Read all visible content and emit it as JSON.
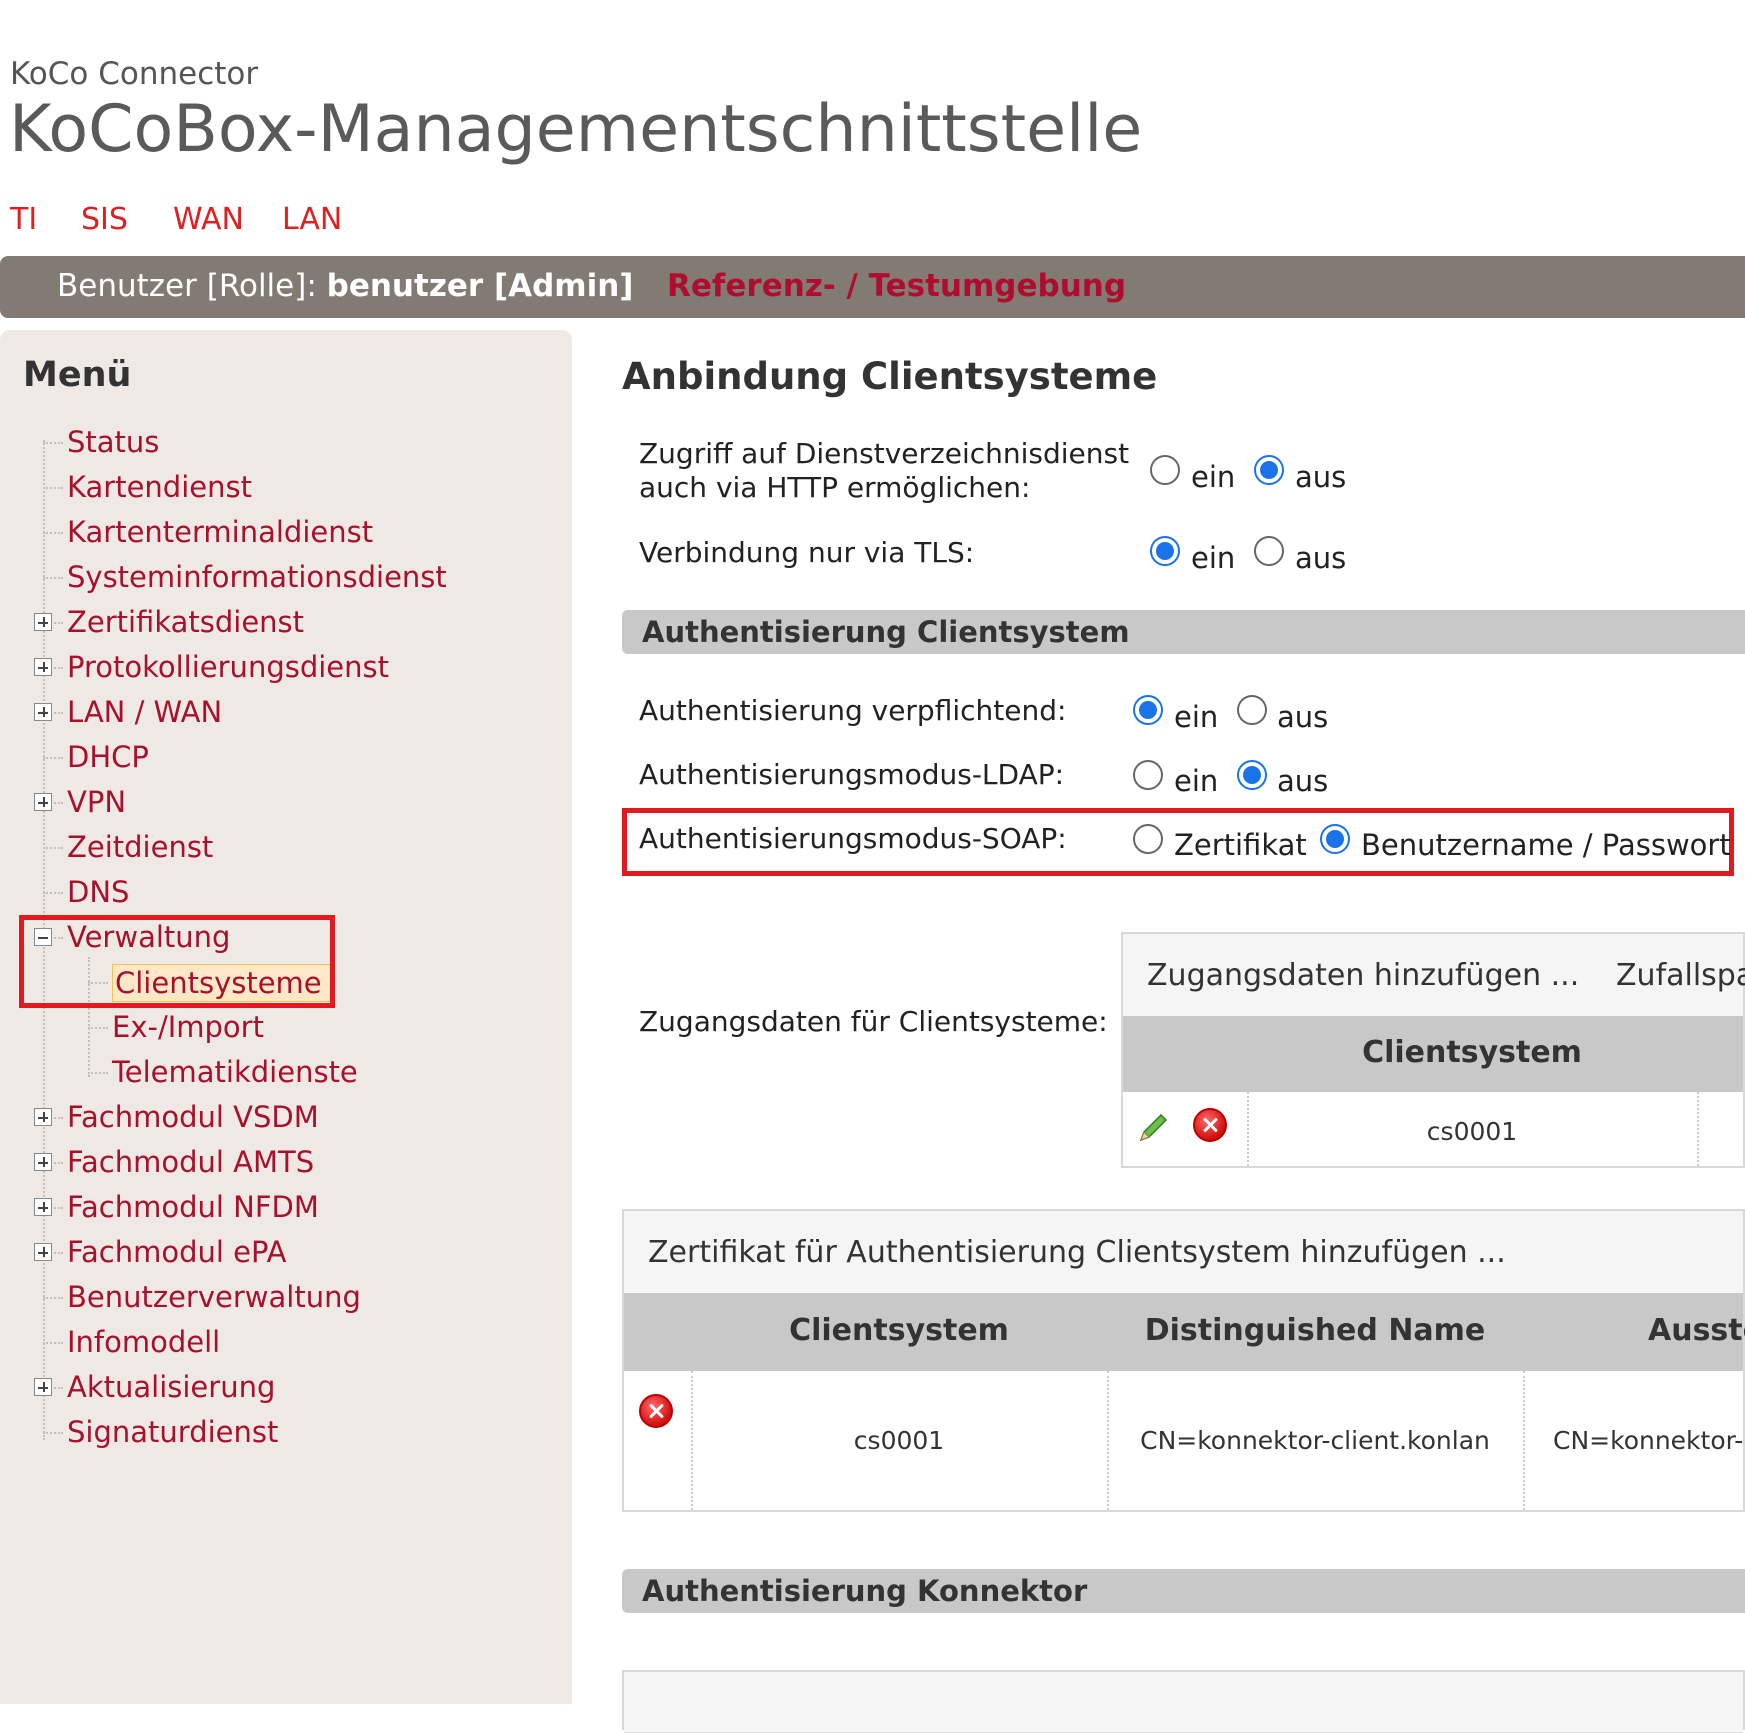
{
  "header": {
    "subtitle": "KoCo Connector",
    "title": "KoCoBox-Managementschnittstelle"
  },
  "top_nav": [
    {
      "label": "TI"
    },
    {
      "label": "SIS"
    },
    {
      "label": "WAN"
    },
    {
      "label": "LAN"
    }
  ],
  "user_bar": {
    "role_label": "Benutzer [Rolle]: ",
    "user": "benutzer [Admin]",
    "environment": "Referenz- / Testumgebung"
  },
  "menu": {
    "title": "Menü",
    "items": [
      {
        "label": "Status",
        "expander": "none"
      },
      {
        "label": "Kartendienst",
        "expander": "none"
      },
      {
        "label": "Kartenterminaldienst",
        "expander": "none"
      },
      {
        "label": "Systeminformationsdienst",
        "expander": "none"
      },
      {
        "label": "Zertifikatsdienst",
        "expander": "plus"
      },
      {
        "label": "Protokollierungsdienst",
        "expander": "plus"
      },
      {
        "label": "LAN / WAN",
        "expander": "plus"
      },
      {
        "label": "DHCP",
        "expander": "none"
      },
      {
        "label": "VPN",
        "expander": "plus"
      },
      {
        "label": "Zeitdienst",
        "expander": "none"
      },
      {
        "label": "DNS",
        "expander": "none"
      },
      {
        "label": "Verwaltung",
        "expander": "minus"
      },
      {
        "label": "Clientsysteme",
        "child": true,
        "selected": true
      },
      {
        "label": "Ex-/Import",
        "child": true
      },
      {
        "label": "Telematikdienste",
        "child": true
      },
      {
        "label": "Fachmodul VSDM",
        "expander": "plus"
      },
      {
        "label": "Fachmodul AMTS",
        "expander": "plus"
      },
      {
        "label": "Fachmodul NFDM",
        "expander": "plus"
      },
      {
        "label": "Fachmodul ePA",
        "expander": "plus"
      },
      {
        "label": "Benutzerverwaltung",
        "expander": "none"
      },
      {
        "label": "Infomodell",
        "expander": "none"
      },
      {
        "label": "Aktualisierung",
        "expander": "plus"
      },
      {
        "label": "Signaturdienst",
        "expander": "none"
      }
    ]
  },
  "main": {
    "heading": "Anbindung Clientsysteme",
    "settings": {
      "http_access_label_line1": "Zugriff auf Dienstverzeichnisdienst",
      "http_access_label_line2": "auch via HTTP ermöglichen:",
      "tls_only_label": "Verbindung nur via TLS:",
      "on": "ein",
      "off": "aus",
      "http_access_value": "aus",
      "tls_only_value": "ein"
    },
    "auth_client": {
      "section_title": "Authentisierung Clientsystem",
      "mandatory_label": "Authentisierung verpflichtend:",
      "mandatory_value": "ein",
      "ldap_label": "Authentisierungsmodus-LDAP:",
      "ldap_value": "aus",
      "soap_label": "Authentisierungsmodus-SOAP:",
      "soap_option_cert": "Zertifikat",
      "soap_option_user": "Benutzername / Passwort",
      "soap_value": "Benutzername / Passwort",
      "credentials_label": "Zugangsdaten für Clientsysteme:",
      "credentials_toolbar": {
        "add": "Zugangsdaten hinzufügen ...",
        "random": "Zufallspa"
      },
      "credentials_table": {
        "headers": [
          "Clientsystem"
        ],
        "rows": [
          {
            "clientsystem": "cs0001"
          }
        ]
      },
      "cert_toolbar_add": "Zertifikat für Authentisierung Clientsystem hinzufügen ...",
      "cert_table": {
        "headers": [
          "Clientsystem",
          "Distinguished Name",
          "Ausste"
        ],
        "rows": [
          {
            "clientsystem": "cs0001",
            "dn": "CN=konnektor-client.konlan",
            "issuer": "CN=konnektor-"
          }
        ]
      }
    },
    "auth_connector": {
      "section_title": "Authentisierung Konnektor"
    }
  },
  "colors": {
    "accent_red": "#a8102b",
    "nav_red": "#e02020",
    "user_bar_bg": "#827b74",
    "sidebar_bg": "#efe9e5",
    "radio_blue": "#1a73e8",
    "highlight_box": "#e21a1f"
  }
}
